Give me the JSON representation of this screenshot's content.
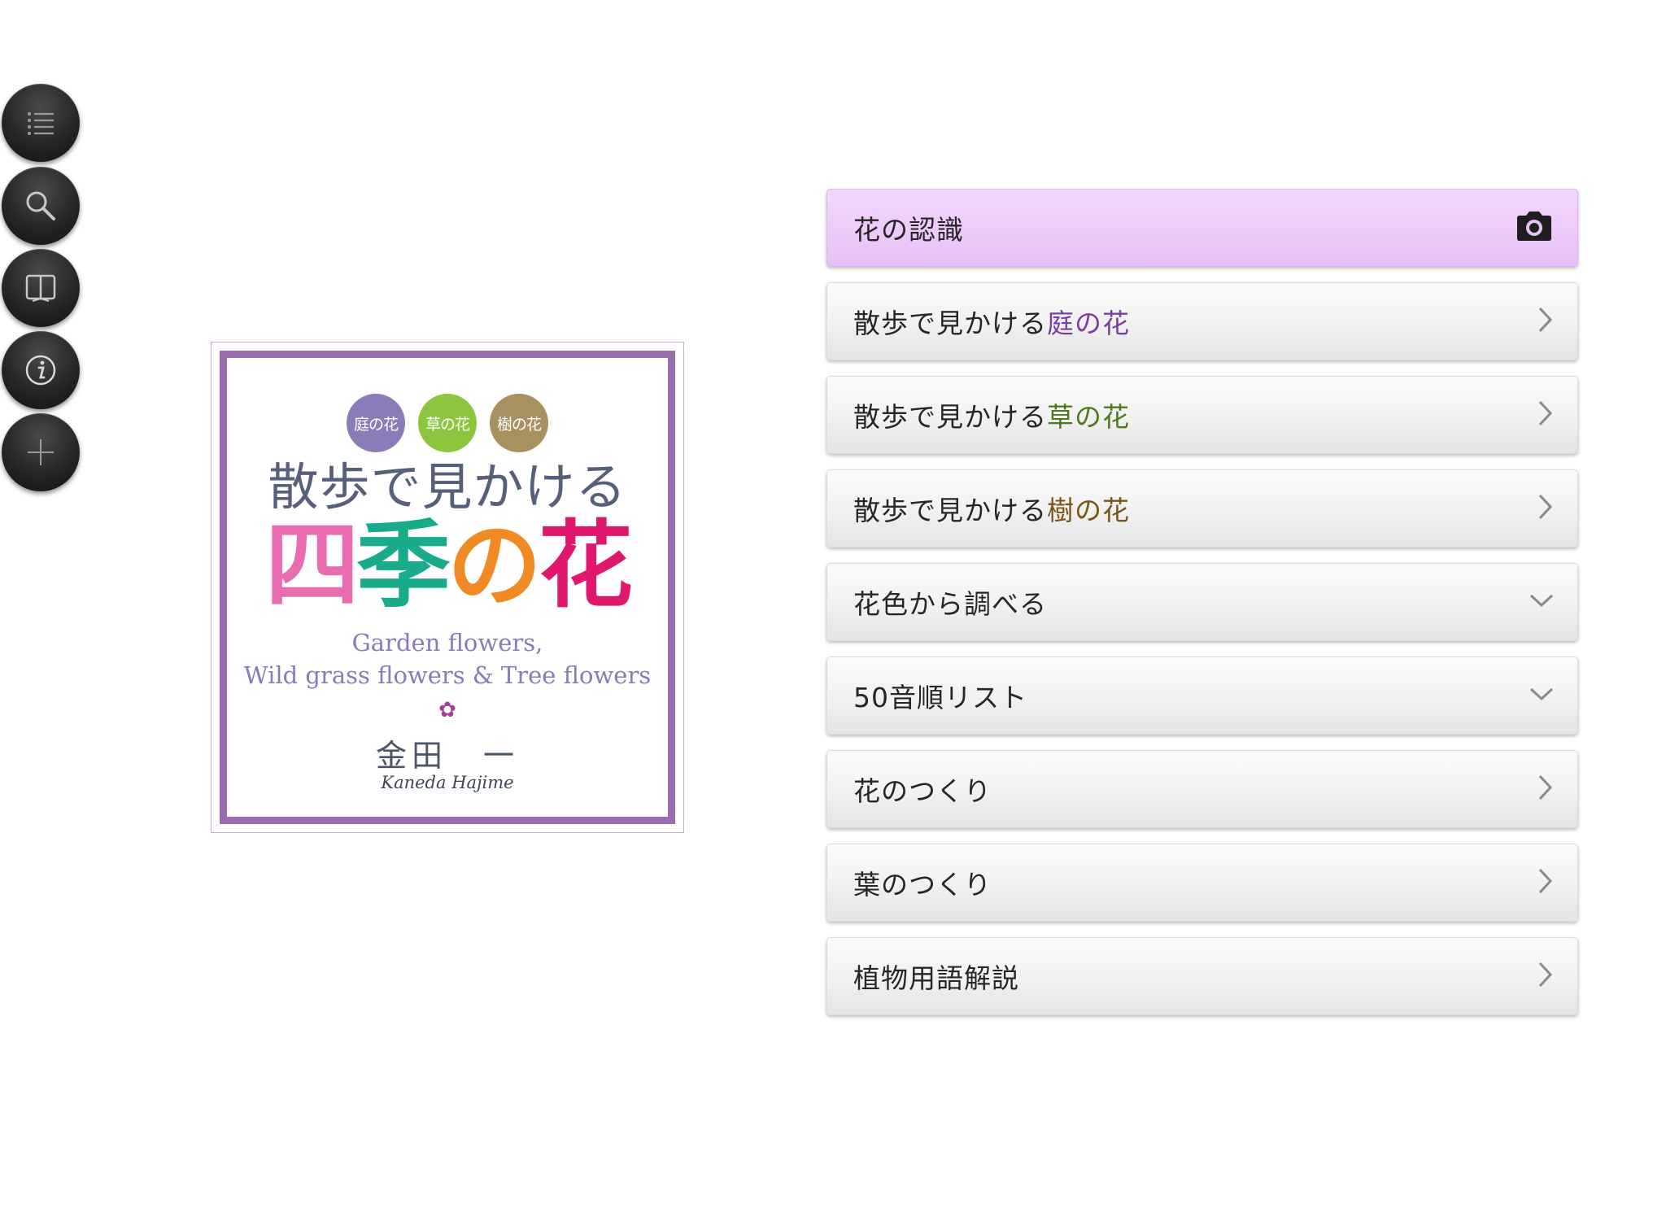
{
  "toolbar": {
    "items": [
      {
        "name": "list",
        "icon": "list-icon"
      },
      {
        "name": "search",
        "icon": "search-icon"
      },
      {
        "name": "book",
        "icon": "book-icon"
      },
      {
        "name": "info",
        "icon": "info-icon"
      },
      {
        "name": "add",
        "icon": "plus-icon"
      }
    ]
  },
  "cover": {
    "badges": [
      {
        "label": "庭の花",
        "color": "#8b7cb8"
      },
      {
        "label": "草の花",
        "color": "#8cc63f"
      },
      {
        "label": "樹の花",
        "color": "#a89060"
      }
    ],
    "subtitle": "散歩で見かける",
    "title_chars": [
      {
        "char": "四",
        "color": "#e96bb0"
      },
      {
        "char": "季",
        "color": "#1aab8a"
      },
      {
        "char": "の",
        "color": "#f08a24"
      },
      {
        "char": "花",
        "color": "#e0186c"
      }
    ],
    "english_line1": "Garden flowers,",
    "english_line2": "Wild grass flowers & Tree flowers",
    "author": "金田　一",
    "author_en": "Kaneda Hajime",
    "frame_color": "#9b6cb0"
  },
  "menu": {
    "items": [
      {
        "prefix": "花の認識",
        "accent": "",
        "accent_color": "",
        "icon": "camera-icon"
      },
      {
        "prefix": "散歩で見かける",
        "accent": "庭の花",
        "accent_color": "#7a3fa0",
        "icon": "chevron-right-icon"
      },
      {
        "prefix": "散歩で見かける",
        "accent": "草の花",
        "accent_color": "#4e7a1e",
        "icon": "chevron-right-icon"
      },
      {
        "prefix": "散歩で見かける",
        "accent": "樹の花",
        "accent_color": "#7a5518",
        "icon": "chevron-right-icon"
      },
      {
        "prefix": "花色から調べる",
        "accent": "",
        "accent_color": "",
        "icon": "chevron-down-icon"
      },
      {
        "prefix": "50音順リスト",
        "accent": "",
        "accent_color": "",
        "icon": "chevron-down-icon"
      },
      {
        "prefix": "花のつくり",
        "accent": "",
        "accent_color": "",
        "icon": "chevron-right-icon"
      },
      {
        "prefix": "葉のつくり",
        "accent": "",
        "accent_color": "",
        "icon": "chevron-right-icon"
      },
      {
        "prefix": "植物用語解説",
        "accent": "",
        "accent_color": "",
        "icon": "chevron-right-icon"
      }
    ]
  },
  "colors": {
    "menu_primary_bg": "#e6c0f7",
    "toolbar_bg": "#262626"
  }
}
